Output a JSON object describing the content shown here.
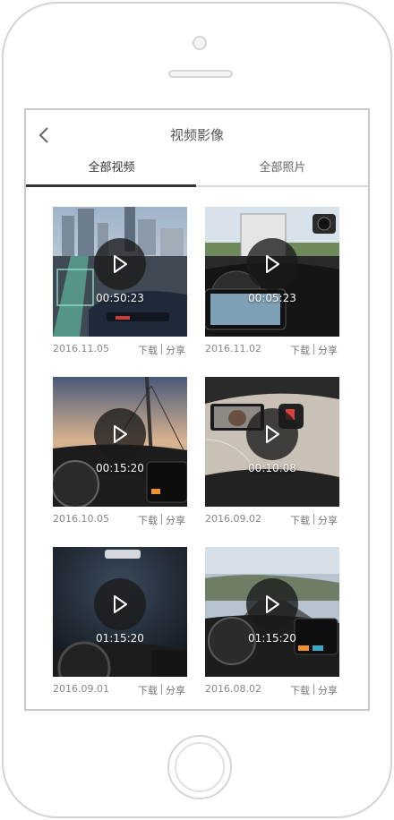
{
  "header": {
    "title": "视频影像"
  },
  "tabs": [
    {
      "label": "全部视频",
      "active": true
    },
    {
      "label": "全部照片",
      "active": false
    }
  ],
  "videos": [
    {
      "duration": "00:50:23",
      "date": "2016.11.05",
      "download": "下载",
      "share": "分享"
    },
    {
      "duration": "00:05:23",
      "date": "2016.11.02",
      "download": "下载",
      "share": "分享"
    },
    {
      "duration": "00:15:20",
      "date": "2016.10.05",
      "download": "下载",
      "share": "分享"
    },
    {
      "duration": "00:10:08",
      "date": "2016.09.02",
      "download": "下载",
      "share": "分享"
    },
    {
      "duration": "01:15:20",
      "date": "2016.09.01",
      "download": "下载",
      "share": "分享"
    },
    {
      "duration": "01:15:20",
      "date": "2016.08.02",
      "download": "下载",
      "share": "分享"
    }
  ],
  "icons": {
    "back": "chevron-left-icon",
    "play": "play-icon"
  }
}
